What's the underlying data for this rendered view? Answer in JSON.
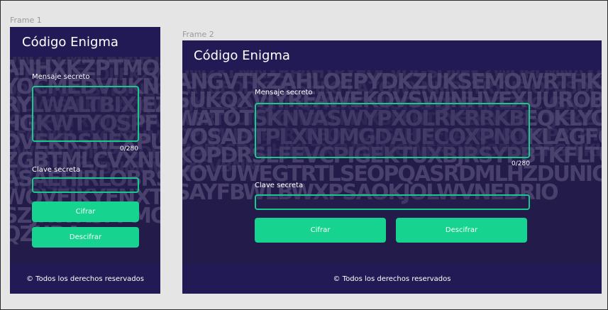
{
  "frames": [
    {
      "label": "Frame 1",
      "title": "Código Enigma",
      "message_label": "Mensaje secreto",
      "counter": "0/280",
      "key_label": "Clave secreta",
      "encrypt_label": "Cifrar",
      "decrypt_label": "Descifrar",
      "footer": "© Todos los derechos reservados"
    },
    {
      "label": "Frame 2",
      "title": "Código Enigma",
      "message_label": "Mensaje secreto",
      "counter": "0/280",
      "key_label": "Clave secreta",
      "encrypt_label": "Cifrar",
      "decrypt_label": "Descifrar",
      "footer": "© Todos los derechos reservados"
    }
  ],
  "colors": {
    "header_bg": "#211a55",
    "accent": "#16d38f",
    "canvas_bg": "#e5e5e5"
  }
}
